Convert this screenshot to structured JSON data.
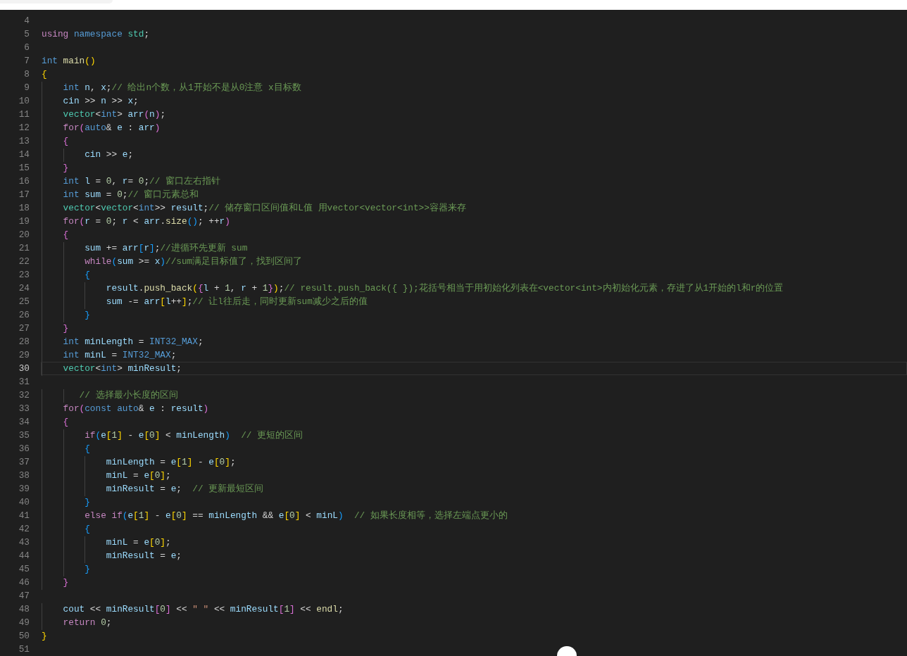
{
  "editor": {
    "lines": [
      {
        "number": "4",
        "current": false
      },
      {
        "number": "5",
        "current": false,
        "tokens": [
          {
            "kind": "ctl",
            "text": "using"
          },
          {
            "kind": "ty",
            "text": " namespace"
          },
          {
            "kind": "cls",
            "text": " std"
          },
          {
            "kind": "p",
            "text": ";"
          }
        ]
      },
      {
        "number": "6",
        "current": false
      },
      {
        "number": "7",
        "current": false,
        "tokens": [
          {
            "kind": "ty",
            "text": "int"
          },
          {
            "kind": "fn",
            "text": " main"
          },
          {
            "kind": "b1",
            "text": "()"
          }
        ]
      },
      {
        "number": "8",
        "current": false,
        "tokens": [
          {
            "kind": "b1",
            "text": "{"
          }
        ]
      },
      {
        "number": "9",
        "current": false,
        "tokens": [
          {
            "kind": "ty",
            "text": "    int"
          },
          {
            "kind": "var",
            "text": " n"
          },
          {
            "kind": "p",
            "text": ", "
          },
          {
            "kind": "var",
            "text": "x"
          },
          {
            "kind": "p",
            "text": ";"
          },
          {
            "kind": "cmt",
            "text": "// 给出n个数，从1开始不是从0注意 x目标数"
          }
        ]
      },
      {
        "number": "10",
        "current": false,
        "tokens": [
          {
            "kind": "var",
            "text": "    cin"
          },
          {
            "kind": "p",
            "text": " >> "
          },
          {
            "kind": "var",
            "text": "n"
          },
          {
            "kind": "p",
            "text": " >> "
          },
          {
            "kind": "var",
            "text": "x"
          },
          {
            "kind": "p",
            "text": ";"
          }
        ]
      },
      {
        "number": "11",
        "current": false,
        "tokens": [
          {
            "kind": "cls",
            "text": "    vector"
          },
          {
            "kind": "p",
            "text": "<"
          },
          {
            "kind": "ty",
            "text": "int"
          },
          {
            "kind": "p",
            "text": "> "
          },
          {
            "kind": "var",
            "text": "arr"
          },
          {
            "kind": "b2",
            "text": "("
          },
          {
            "kind": "var",
            "text": "n"
          },
          {
            "kind": "b2",
            "text": ")"
          },
          {
            "kind": "p",
            "text": ";"
          }
        ]
      },
      {
        "number": "12",
        "current": false,
        "tokens": [
          {
            "kind": "ctl",
            "text": "    for"
          },
          {
            "kind": "b2",
            "text": "("
          },
          {
            "kind": "ty",
            "text": "auto"
          },
          {
            "kind": "p",
            "text": "& "
          },
          {
            "kind": "var",
            "text": "e"
          },
          {
            "kind": "p",
            "text": " : "
          },
          {
            "kind": "var",
            "text": "arr"
          },
          {
            "kind": "b2",
            "text": ")"
          }
        ]
      },
      {
        "number": "13",
        "current": false,
        "tokens": [
          {
            "kind": "b2",
            "text": "    {"
          }
        ]
      },
      {
        "number": "14",
        "current": false,
        "tokens": [
          {
            "kind": "var",
            "text": "        cin"
          },
          {
            "kind": "p",
            "text": " >> "
          },
          {
            "kind": "var",
            "text": "e"
          },
          {
            "kind": "p",
            "text": ";"
          }
        ]
      },
      {
        "number": "15",
        "current": false,
        "tokens": [
          {
            "kind": "b2",
            "text": "    }"
          }
        ]
      },
      {
        "number": "16",
        "current": false,
        "tokens": [
          {
            "kind": "ty",
            "text": "    int"
          },
          {
            "kind": "var",
            "text": " l"
          },
          {
            "kind": "p",
            "text": " = "
          },
          {
            "kind": "num",
            "text": "0"
          },
          {
            "kind": "p",
            "text": ", "
          },
          {
            "kind": "var",
            "text": "r"
          },
          {
            "kind": "p",
            "text": "= "
          },
          {
            "kind": "num",
            "text": "0"
          },
          {
            "kind": "p",
            "text": ";"
          },
          {
            "kind": "cmt",
            "text": "// 窗口左右指针"
          }
        ]
      },
      {
        "number": "17",
        "current": false,
        "tokens": [
          {
            "kind": "ty",
            "text": "    int"
          },
          {
            "kind": "var",
            "text": " sum"
          },
          {
            "kind": "p",
            "text": " = "
          },
          {
            "kind": "num",
            "text": "0"
          },
          {
            "kind": "p",
            "text": ";"
          },
          {
            "kind": "cmt",
            "text": "// 窗口元素总和"
          }
        ]
      },
      {
        "number": "18",
        "current": false,
        "tokens": [
          {
            "kind": "cls",
            "text": "    vector"
          },
          {
            "kind": "p",
            "text": "<"
          },
          {
            "kind": "cls",
            "text": "vector"
          },
          {
            "kind": "p",
            "text": "<"
          },
          {
            "kind": "ty",
            "text": "int"
          },
          {
            "kind": "p",
            "text": ">> "
          },
          {
            "kind": "var",
            "text": "result"
          },
          {
            "kind": "p",
            "text": ";"
          },
          {
            "kind": "cmt",
            "text": "// 储存窗口区间值和L值 用vector<vector<int>>容器来存"
          }
        ]
      },
      {
        "number": "19",
        "current": false,
        "tokens": [
          {
            "kind": "ctl",
            "text": "    for"
          },
          {
            "kind": "b2",
            "text": "("
          },
          {
            "kind": "var",
            "text": "r"
          },
          {
            "kind": "p",
            "text": " = "
          },
          {
            "kind": "num",
            "text": "0"
          },
          {
            "kind": "p",
            "text": "; "
          },
          {
            "kind": "var",
            "text": "r"
          },
          {
            "kind": "p",
            "text": " < "
          },
          {
            "kind": "var",
            "text": "arr"
          },
          {
            "kind": "p",
            "text": "."
          },
          {
            "kind": "fn",
            "text": "size"
          },
          {
            "kind": "b3",
            "text": "()"
          },
          {
            "kind": "p",
            "text": "; ++"
          },
          {
            "kind": "var",
            "text": "r"
          },
          {
            "kind": "b2",
            "text": ")"
          }
        ]
      },
      {
        "number": "20",
        "current": false,
        "tokens": [
          {
            "kind": "b2",
            "text": "    {"
          }
        ]
      },
      {
        "number": "21",
        "current": false,
        "tokens": [
          {
            "kind": "var",
            "text": "        sum"
          },
          {
            "kind": "p",
            "text": " += "
          },
          {
            "kind": "var",
            "text": "arr"
          },
          {
            "kind": "b3",
            "text": "["
          },
          {
            "kind": "var",
            "text": "r"
          },
          {
            "kind": "b3",
            "text": "]"
          },
          {
            "kind": "p",
            "text": ";"
          },
          {
            "kind": "cmt",
            "text": "//进循环先更新 sum"
          }
        ]
      },
      {
        "number": "22",
        "current": false,
        "tokens": [
          {
            "kind": "ctl",
            "text": "        while"
          },
          {
            "kind": "b3",
            "text": "("
          },
          {
            "kind": "var",
            "text": "sum"
          },
          {
            "kind": "p",
            "text": " >= "
          },
          {
            "kind": "var",
            "text": "x"
          },
          {
            "kind": "b3",
            "text": ")"
          },
          {
            "kind": "cmt",
            "text": "//sum满足目标值了，找到区间了"
          }
        ]
      },
      {
        "number": "23",
        "current": false,
        "tokens": [
          {
            "kind": "b3",
            "text": "        {"
          }
        ]
      },
      {
        "number": "24",
        "current": false,
        "tokens": [
          {
            "kind": "var",
            "text": "            result"
          },
          {
            "kind": "p",
            "text": "."
          },
          {
            "kind": "fn",
            "text": "push_back"
          },
          {
            "kind": "b1",
            "text": "("
          },
          {
            "kind": "b2",
            "text": "{"
          },
          {
            "kind": "var",
            "text": "l"
          },
          {
            "kind": "p",
            "text": " + "
          },
          {
            "kind": "num",
            "text": "1"
          },
          {
            "kind": "p",
            "text": ", "
          },
          {
            "kind": "var",
            "text": "r"
          },
          {
            "kind": "p",
            "text": " + "
          },
          {
            "kind": "num",
            "text": "1"
          },
          {
            "kind": "b2",
            "text": "}"
          },
          {
            "kind": "b1",
            "text": ")"
          },
          {
            "kind": "p",
            "text": ";"
          },
          {
            "kind": "cmt",
            "text": "// result.push_back({ });花括号相当于用初始化列表在<vector<int>内初始化元素，存进了从1开始的l和r的位置"
          }
        ]
      },
      {
        "number": "25",
        "current": false,
        "tokens": [
          {
            "kind": "var",
            "text": "            sum"
          },
          {
            "kind": "p",
            "text": " -= "
          },
          {
            "kind": "var",
            "text": "arr"
          },
          {
            "kind": "b1",
            "text": "["
          },
          {
            "kind": "var",
            "text": "l"
          },
          {
            "kind": "p",
            "text": "++"
          },
          {
            "kind": "b1",
            "text": "]"
          },
          {
            "kind": "p",
            "text": ";"
          },
          {
            "kind": "cmt",
            "text": "// 让l往后走，同时更新sum减少之后的值"
          }
        ]
      },
      {
        "number": "26",
        "current": false,
        "tokens": [
          {
            "kind": "b3",
            "text": "        }"
          }
        ]
      },
      {
        "number": "27",
        "current": false,
        "tokens": [
          {
            "kind": "b2",
            "text": "    }"
          }
        ]
      },
      {
        "number": "28",
        "current": false,
        "tokens": [
          {
            "kind": "ty",
            "text": "    int"
          },
          {
            "kind": "var",
            "text": " minLength"
          },
          {
            "kind": "p",
            "text": " = "
          },
          {
            "kind": "mac",
            "text": "INT32_MAX"
          },
          {
            "kind": "p",
            "text": ";"
          }
        ]
      },
      {
        "number": "29",
        "current": false,
        "tokens": [
          {
            "kind": "ty",
            "text": "    int"
          },
          {
            "kind": "var",
            "text": " minL"
          },
          {
            "kind": "p",
            "text": " = "
          },
          {
            "kind": "mac",
            "text": "INT32_MAX"
          },
          {
            "kind": "p",
            "text": ";"
          }
        ]
      },
      {
        "number": "30",
        "current": true,
        "tokens": [
          {
            "kind": "cls",
            "text": "    vector"
          },
          {
            "kind": "p",
            "text": "<"
          },
          {
            "kind": "ty",
            "text": "int"
          },
          {
            "kind": "p",
            "text": "> "
          },
          {
            "kind": "var",
            "text": "minResult"
          },
          {
            "kind": "p",
            "text": ";"
          }
        ]
      },
      {
        "number": "31",
        "current": false
      },
      {
        "number": "32",
        "current": false,
        "tokens": [
          {
            "kind": "cmt",
            "text": "       // 选择最小长度的区间"
          }
        ]
      },
      {
        "number": "33",
        "current": false,
        "tokens": [
          {
            "kind": "ctl",
            "text": "    for"
          },
          {
            "kind": "b2",
            "text": "("
          },
          {
            "kind": "ty",
            "text": "const"
          },
          {
            "kind": "ty",
            "text": " auto"
          },
          {
            "kind": "p",
            "text": "& "
          },
          {
            "kind": "var",
            "text": "e"
          },
          {
            "kind": "p",
            "text": " : "
          },
          {
            "kind": "var",
            "text": "result"
          },
          {
            "kind": "b2",
            "text": ")"
          }
        ]
      },
      {
        "number": "34",
        "current": false,
        "tokens": [
          {
            "kind": "b2",
            "text": "    {"
          }
        ]
      },
      {
        "number": "35",
        "current": false,
        "tokens": [
          {
            "kind": "ctl",
            "text": "        if"
          },
          {
            "kind": "b3",
            "text": "("
          },
          {
            "kind": "var",
            "text": "e"
          },
          {
            "kind": "b1",
            "text": "["
          },
          {
            "kind": "num",
            "text": "1"
          },
          {
            "kind": "b1",
            "text": "]"
          },
          {
            "kind": "p",
            "text": " - "
          },
          {
            "kind": "var",
            "text": "e"
          },
          {
            "kind": "b1",
            "text": "["
          },
          {
            "kind": "num",
            "text": "0"
          },
          {
            "kind": "b1",
            "text": "]"
          },
          {
            "kind": "p",
            "text": " < "
          },
          {
            "kind": "var",
            "text": "minLength"
          },
          {
            "kind": "b3",
            "text": ")"
          },
          {
            "kind": "cmt",
            "text": "  // 更短的区间"
          }
        ]
      },
      {
        "number": "36",
        "current": false,
        "tokens": [
          {
            "kind": "b3",
            "text": "        {"
          }
        ]
      },
      {
        "number": "37",
        "current": false,
        "tokens": [
          {
            "kind": "var",
            "text": "            minLength"
          },
          {
            "kind": "p",
            "text": " = "
          },
          {
            "kind": "var",
            "text": "e"
          },
          {
            "kind": "b1",
            "text": "["
          },
          {
            "kind": "num",
            "text": "1"
          },
          {
            "kind": "b1",
            "text": "]"
          },
          {
            "kind": "p",
            "text": " - "
          },
          {
            "kind": "var",
            "text": "e"
          },
          {
            "kind": "b1",
            "text": "["
          },
          {
            "kind": "num",
            "text": "0"
          },
          {
            "kind": "b1",
            "text": "]"
          },
          {
            "kind": "p",
            "text": ";"
          }
        ]
      },
      {
        "number": "38",
        "current": false,
        "tokens": [
          {
            "kind": "var",
            "text": "            minL"
          },
          {
            "kind": "p",
            "text": " = "
          },
          {
            "kind": "var",
            "text": "e"
          },
          {
            "kind": "b1",
            "text": "["
          },
          {
            "kind": "num",
            "text": "0"
          },
          {
            "kind": "b1",
            "text": "]"
          },
          {
            "kind": "p",
            "text": ";"
          }
        ]
      },
      {
        "number": "39",
        "current": false,
        "tokens": [
          {
            "kind": "var",
            "text": "            minResult"
          },
          {
            "kind": "p",
            "text": " = "
          },
          {
            "kind": "var",
            "text": "e"
          },
          {
            "kind": "p",
            "text": ";"
          },
          {
            "kind": "cmt",
            "text": "  // 更新最短区间"
          }
        ]
      },
      {
        "number": "40",
        "current": false,
        "tokens": [
          {
            "kind": "b3",
            "text": "        }"
          }
        ]
      },
      {
        "number": "41",
        "current": false,
        "tokens": [
          {
            "kind": "ctl",
            "text": "        else"
          },
          {
            "kind": "ctl",
            "text": " if"
          },
          {
            "kind": "b3",
            "text": "("
          },
          {
            "kind": "var",
            "text": "e"
          },
          {
            "kind": "b1",
            "text": "["
          },
          {
            "kind": "num",
            "text": "1"
          },
          {
            "kind": "b1",
            "text": "]"
          },
          {
            "kind": "p",
            "text": " - "
          },
          {
            "kind": "var",
            "text": "e"
          },
          {
            "kind": "b1",
            "text": "["
          },
          {
            "kind": "num",
            "text": "0"
          },
          {
            "kind": "b1",
            "text": "]"
          },
          {
            "kind": "p",
            "text": " == "
          },
          {
            "kind": "var",
            "text": "minLength"
          },
          {
            "kind": "p",
            "text": " && "
          },
          {
            "kind": "var",
            "text": "e"
          },
          {
            "kind": "b1",
            "text": "["
          },
          {
            "kind": "num",
            "text": "0"
          },
          {
            "kind": "b1",
            "text": "]"
          },
          {
            "kind": "p",
            "text": " < "
          },
          {
            "kind": "var",
            "text": "minL"
          },
          {
            "kind": "b3",
            "text": ")"
          },
          {
            "kind": "cmt",
            "text": "  // 如果长度相等，选择左端点更小的"
          }
        ]
      },
      {
        "number": "42",
        "current": false,
        "tokens": [
          {
            "kind": "b3",
            "text": "        {"
          }
        ]
      },
      {
        "number": "43",
        "current": false,
        "tokens": [
          {
            "kind": "var",
            "text": "            minL"
          },
          {
            "kind": "p",
            "text": " = "
          },
          {
            "kind": "var",
            "text": "e"
          },
          {
            "kind": "b1",
            "text": "["
          },
          {
            "kind": "num",
            "text": "0"
          },
          {
            "kind": "b1",
            "text": "]"
          },
          {
            "kind": "p",
            "text": ";"
          }
        ]
      },
      {
        "number": "44",
        "current": false,
        "tokens": [
          {
            "kind": "var",
            "text": "            minResult"
          },
          {
            "kind": "p",
            "text": " = "
          },
          {
            "kind": "var",
            "text": "e"
          },
          {
            "kind": "p",
            "text": ";"
          }
        ]
      },
      {
        "number": "45",
        "current": false,
        "tokens": [
          {
            "kind": "b3",
            "text": "        }"
          }
        ]
      },
      {
        "number": "46",
        "current": false,
        "tokens": [
          {
            "kind": "b2",
            "text": "    }"
          }
        ]
      },
      {
        "number": "47",
        "current": false
      },
      {
        "number": "48",
        "current": false,
        "tokens": [
          {
            "kind": "var",
            "text": "    cout"
          },
          {
            "kind": "p",
            "text": " << "
          },
          {
            "kind": "var",
            "text": "minResult"
          },
          {
            "kind": "b2",
            "text": "["
          },
          {
            "kind": "num",
            "text": "0"
          },
          {
            "kind": "b2",
            "text": "]"
          },
          {
            "kind": "p",
            "text": " << "
          },
          {
            "kind": "str",
            "text": "\" \""
          },
          {
            "kind": "p",
            "text": " << "
          },
          {
            "kind": "var",
            "text": "minResult"
          },
          {
            "kind": "b2",
            "text": "["
          },
          {
            "kind": "num",
            "text": "1"
          },
          {
            "kind": "b2",
            "text": "]"
          },
          {
            "kind": "p",
            "text": " << "
          },
          {
            "kind": "fn",
            "text": "endl"
          },
          {
            "kind": "p",
            "text": ";"
          }
        ]
      },
      {
        "number": "49",
        "current": false,
        "tokens": [
          {
            "kind": "ctl",
            "text": "    return"
          },
          {
            "kind": "num",
            "text": " 0"
          },
          {
            "kind": "p",
            "text": ";"
          }
        ]
      },
      {
        "number": "50",
        "current": false,
        "tokens": [
          {
            "kind": "b1",
            "text": "}"
          }
        ]
      },
      {
        "number": "51",
        "current": false
      }
    ]
  }
}
